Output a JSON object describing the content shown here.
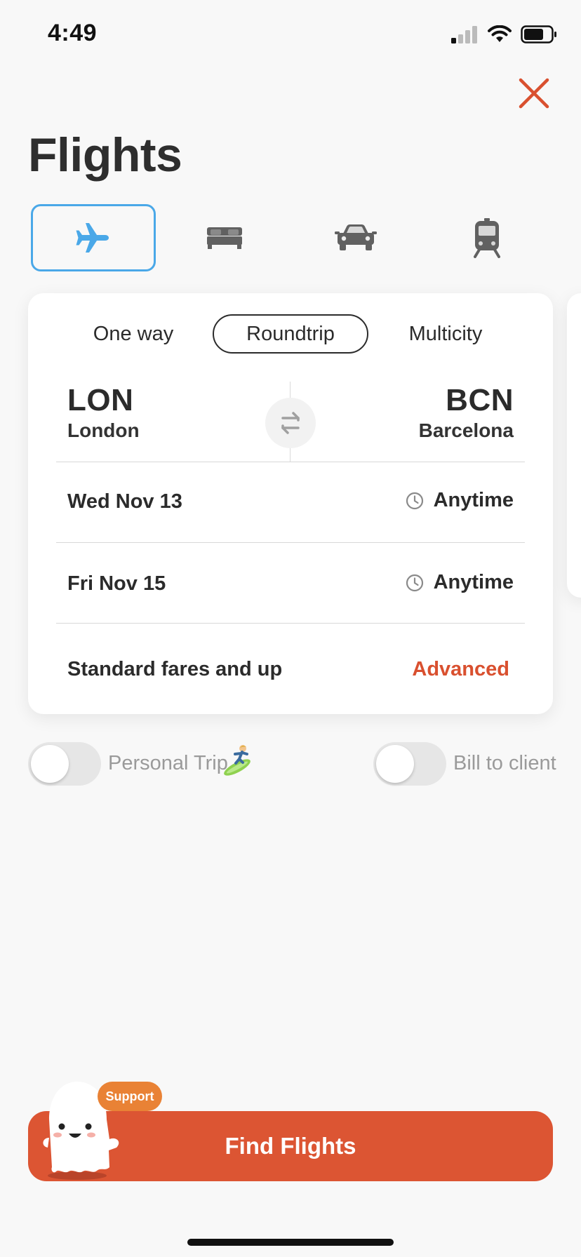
{
  "status_bar": {
    "time": "4:49"
  },
  "page": {
    "title": "Flights"
  },
  "modes": [
    {
      "name": "flights",
      "icon": "airplane-icon",
      "active": true
    },
    {
      "name": "hotels",
      "icon": "bed-icon",
      "active": false
    },
    {
      "name": "cars",
      "icon": "car-icon",
      "active": false
    },
    {
      "name": "trains",
      "icon": "train-icon",
      "active": false
    }
  ],
  "trip_types": {
    "one_way": "One way",
    "roundtrip": "Roundtrip",
    "multicity": "Multicity",
    "selected": "Roundtrip"
  },
  "origin": {
    "code": "LON",
    "city": "London"
  },
  "destination": {
    "code": "BCN",
    "city": "Barcelona"
  },
  "depart": {
    "date": "Wed Nov 13",
    "time": "Anytime"
  },
  "return": {
    "date": "Fri Nov 15",
    "time": "Anytime"
  },
  "fares": {
    "label": "Standard fares and up",
    "advanced_label": "Advanced"
  },
  "toggles": {
    "personal_trip": {
      "label": "Personal Trip",
      "emoji": "🏄",
      "on": false
    },
    "bill_to_client": {
      "label": "Bill to client",
      "on": false
    }
  },
  "support": {
    "label": "Support"
  },
  "find_button": {
    "label": "Find Flights"
  },
  "colors": {
    "accent": "#dc5533",
    "active_tab_border": "#4aa8e8",
    "support_badge": "#e98235"
  }
}
